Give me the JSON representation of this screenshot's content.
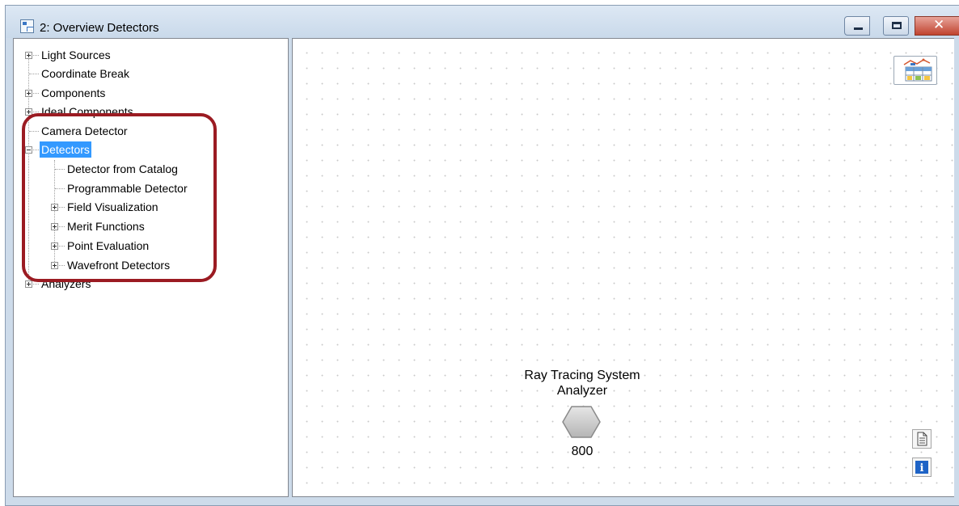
{
  "window": {
    "title": "2: Overview Detectors",
    "close_symbol": "✕"
  },
  "tree": {
    "nodes": [
      {
        "label": "Light Sources",
        "expander": "plus"
      },
      {
        "label": "Coordinate Break",
        "expander": "none"
      },
      {
        "label": "Components",
        "expander": "plus"
      },
      {
        "label": "Ideal Components",
        "expander": "plus"
      },
      {
        "label": "Camera Detector",
        "expander": "none"
      },
      {
        "label": "Detectors",
        "expander": "minus",
        "selected": true
      },
      {
        "label": "Detector from Catalog",
        "expander": "none"
      },
      {
        "label": "Programmable Detector",
        "expander": "none"
      },
      {
        "label": "Field Visualization",
        "expander": "plus"
      },
      {
        "label": "Merit Functions",
        "expander": "plus"
      },
      {
        "label": "Point Evaluation",
        "expander": "plus"
      },
      {
        "label": "Wavefront Detectors",
        "expander": "plus"
      },
      {
        "label": "Analyzers",
        "expander": "plus"
      }
    ]
  },
  "canvas": {
    "analyzer": {
      "label_line1": "Ray Tracing System",
      "label_line2": "Analyzer",
      "number": "800"
    },
    "info_symbol": "i"
  },
  "colors": {
    "selection": "#3399ff",
    "highlight_ring": "#9b1b22",
    "close_button": "#c0432f"
  },
  "icons": {
    "app": "overview-diagram-icon",
    "chart": "spreadsheet-chart-icon",
    "document": "document-icon",
    "info": "info-icon"
  }
}
